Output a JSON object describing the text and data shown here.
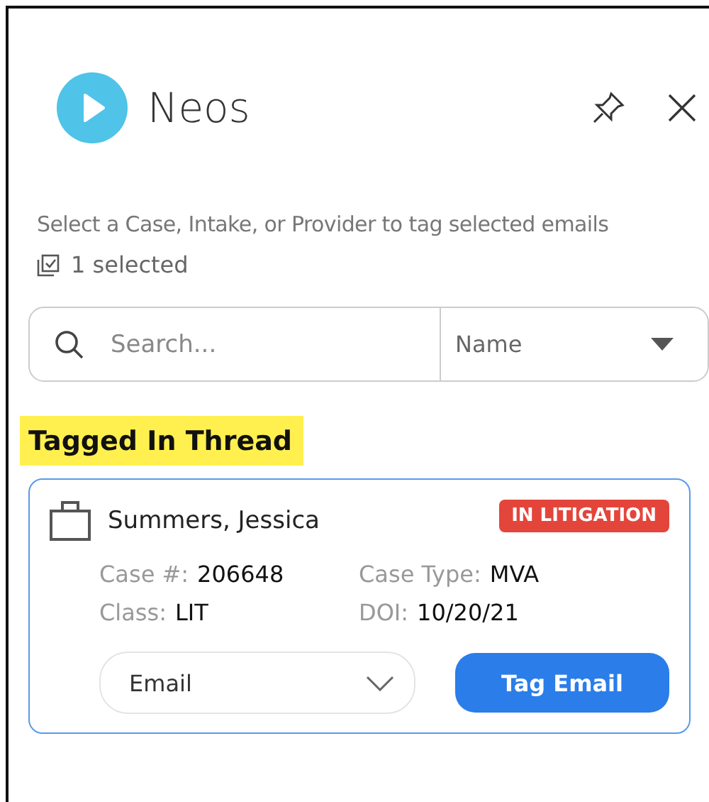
{
  "header": {
    "title": "Neos"
  },
  "instructions": "Select a Case, Intake, or Provider to tag selected emails",
  "selection_count": "1 selected",
  "search": {
    "placeholder": "Search...",
    "filter": "Name"
  },
  "section_title": "Tagged In Thread",
  "cases": [
    {
      "name": "Summers, Jessica",
      "status": "IN LITIGATION",
      "fields": [
        {
          "label": "Case #:",
          "value": "206648"
        },
        {
          "label": "Case Type:",
          "value": "MVA"
        },
        {
          "label": "Class:",
          "value": "LIT"
        },
        {
          "label": "DOI:",
          "value": "10/20/21"
        }
      ],
      "tag_type": "Email",
      "action": "Tag Email"
    }
  ]
}
